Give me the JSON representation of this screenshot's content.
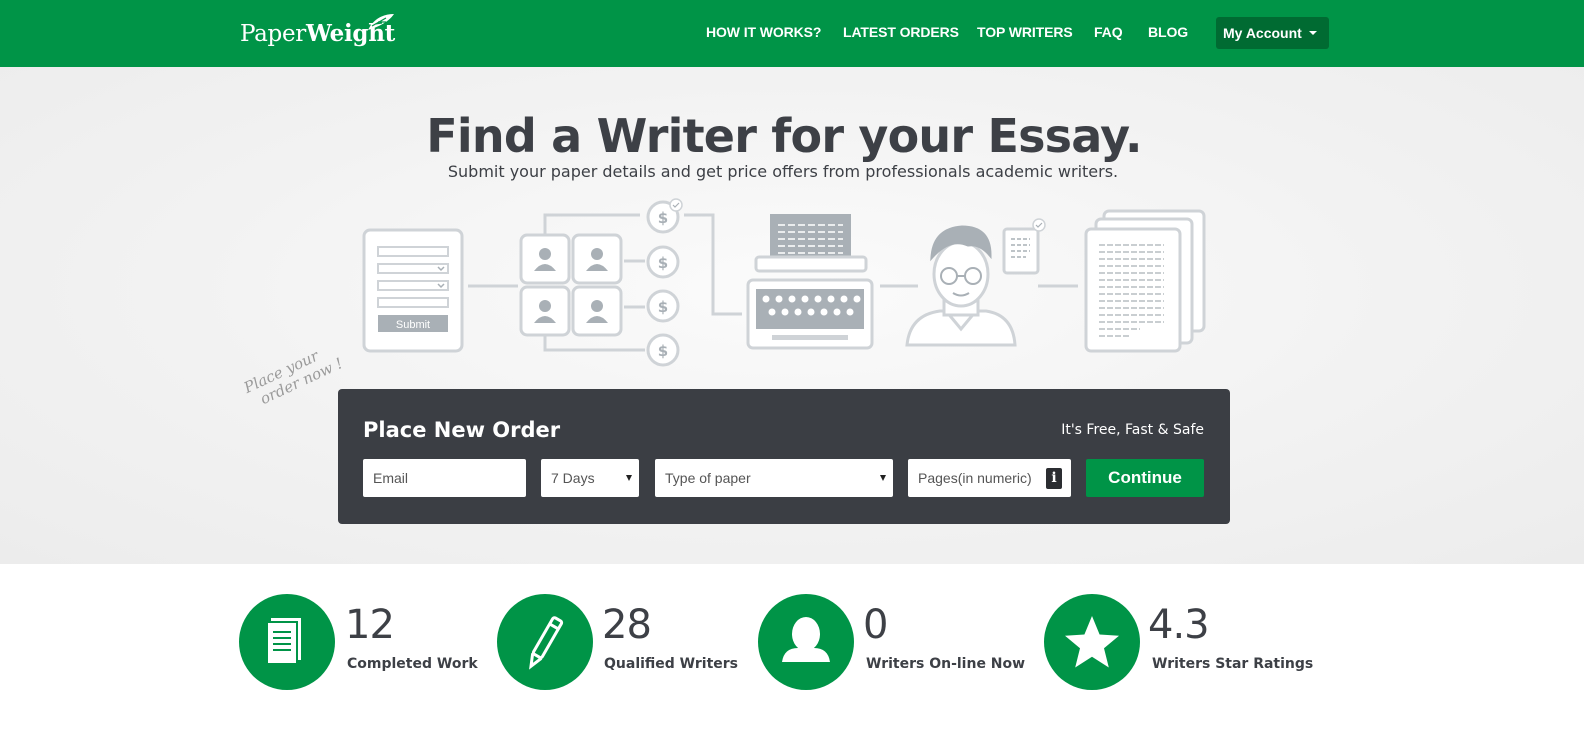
{
  "brand": {
    "logo_part1": "Paper",
    "logo_part2": "Weight"
  },
  "nav": {
    "links": [
      "HOW IT WORKS?",
      "LATEST ORDERS",
      "TOP WRITERS",
      "FAQ",
      "BLOG"
    ],
    "account_label": "My Account"
  },
  "hero": {
    "title": "Find a Writer for your Essay.",
    "subtitle": "Submit your paper details and get price offers from professionals academic writers.",
    "form_submit_label": "Submit",
    "handnote_line1": "Place your",
    "handnote_line2": "order now !"
  },
  "order": {
    "title": "Place New Order",
    "tagline": "It's Free, Fast & Safe",
    "email_placeholder": "Email",
    "deadline_value": "7 Days",
    "paper_type_value": "Type of paper",
    "pages_placeholder": "Pages(in numeric)",
    "info_glyph": "i",
    "continue_label": "Continue"
  },
  "stats": [
    {
      "value": "12",
      "label": "Completed Work",
      "icon": "document-icon"
    },
    {
      "value": "28",
      "label": "Qualified Writers",
      "icon": "pen-icon"
    },
    {
      "value": "0",
      "label": "Writers On-line Now",
      "icon": "user-icon"
    },
    {
      "value": "4.3",
      "label": "Writers Star Ratings",
      "icon": "star-icon"
    }
  ],
  "colors": {
    "brand_green": "#009447",
    "dark_green": "#006b32",
    "panel_dark": "#3b3e44",
    "text_dark": "#3d4046",
    "illustration_gray": "#a9b0b6"
  }
}
